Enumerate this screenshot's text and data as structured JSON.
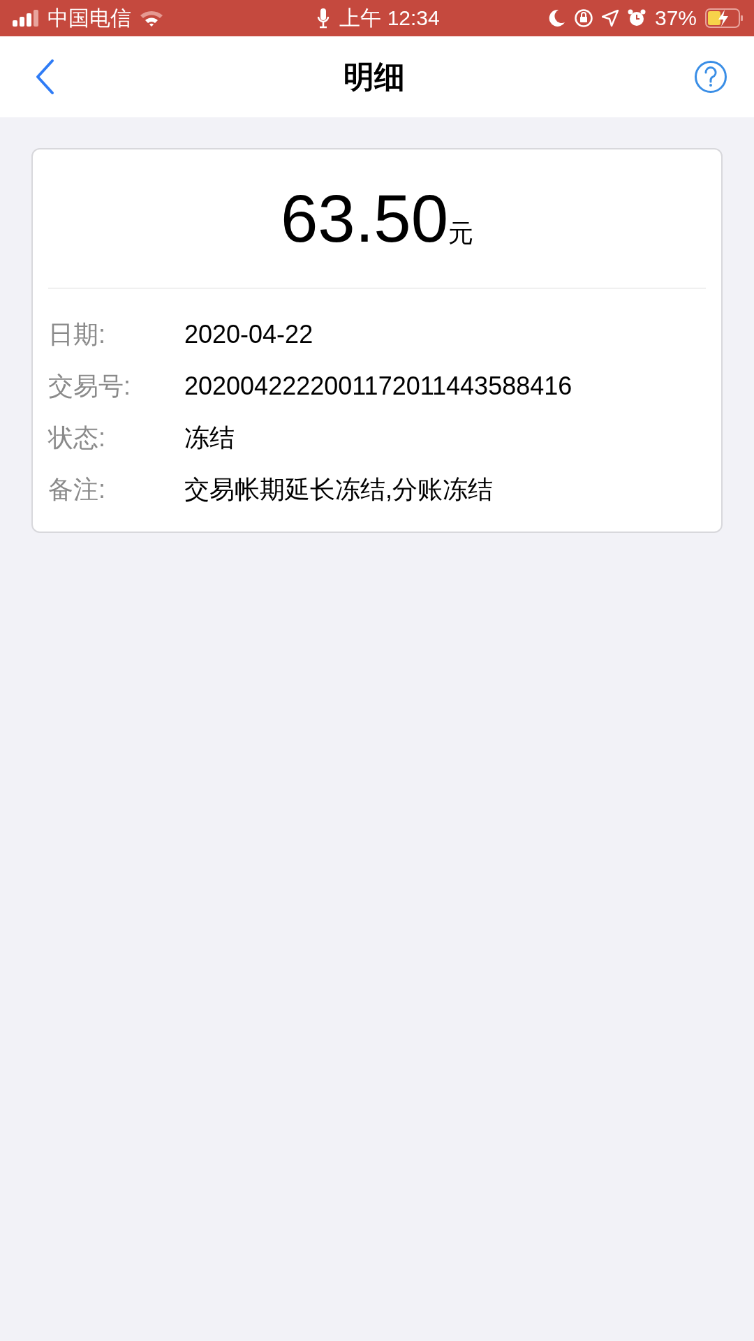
{
  "status_bar": {
    "carrier": "中国电信",
    "time": "上午 12:34",
    "battery": "37%"
  },
  "nav": {
    "title": "明细"
  },
  "amount": {
    "value": "63.50",
    "unit": "元"
  },
  "details": [
    {
      "label": "日期:",
      "value": "2020-04-22"
    },
    {
      "label": "交易号:",
      "value": "2020042222001172011443588416"
    },
    {
      "label": "状态:",
      "value": "冻结"
    },
    {
      "label": "备注:",
      "value": "交易帐期延长冻结,分账冻结"
    }
  ]
}
